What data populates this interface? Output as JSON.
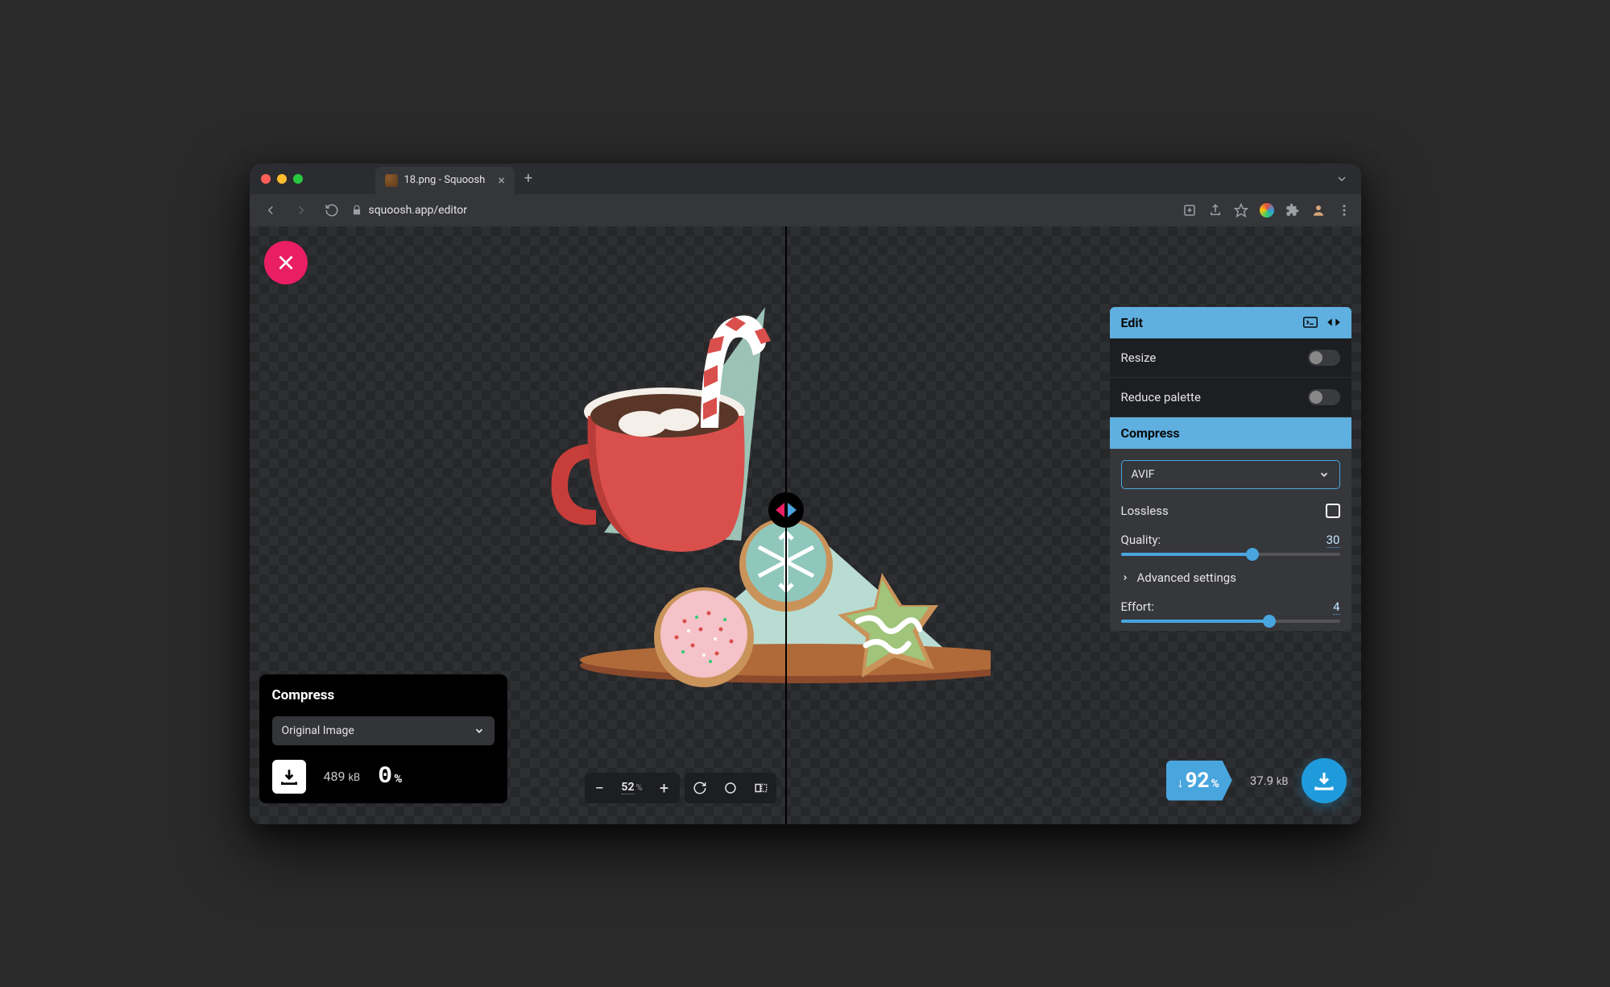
{
  "browser": {
    "tab_title": "18.png - Squoosh",
    "url": "squoosh.app/editor"
  },
  "left_panel": {
    "heading": "Compress",
    "format_selected": "Original Image",
    "filesize_value": "489",
    "filesize_unit": "kB",
    "savings_pct": "0"
  },
  "right_panel": {
    "edit_heading": "Edit",
    "resize_label": "Resize",
    "reduce_palette_label": "Reduce palette",
    "compress_heading": "Compress",
    "format_selected": "AVIF",
    "lossless_label": "Lossless",
    "quality_label": "Quality:",
    "quality_value": "30",
    "quality_pct": 60,
    "advanced_label": "Advanced settings",
    "effort_label": "Effort:",
    "effort_value": "4",
    "effort_pct": 68
  },
  "right_download": {
    "savings_pct": "92",
    "output_size_value": "37.9",
    "output_size_unit": "kB"
  },
  "zoom": {
    "value": "52"
  }
}
